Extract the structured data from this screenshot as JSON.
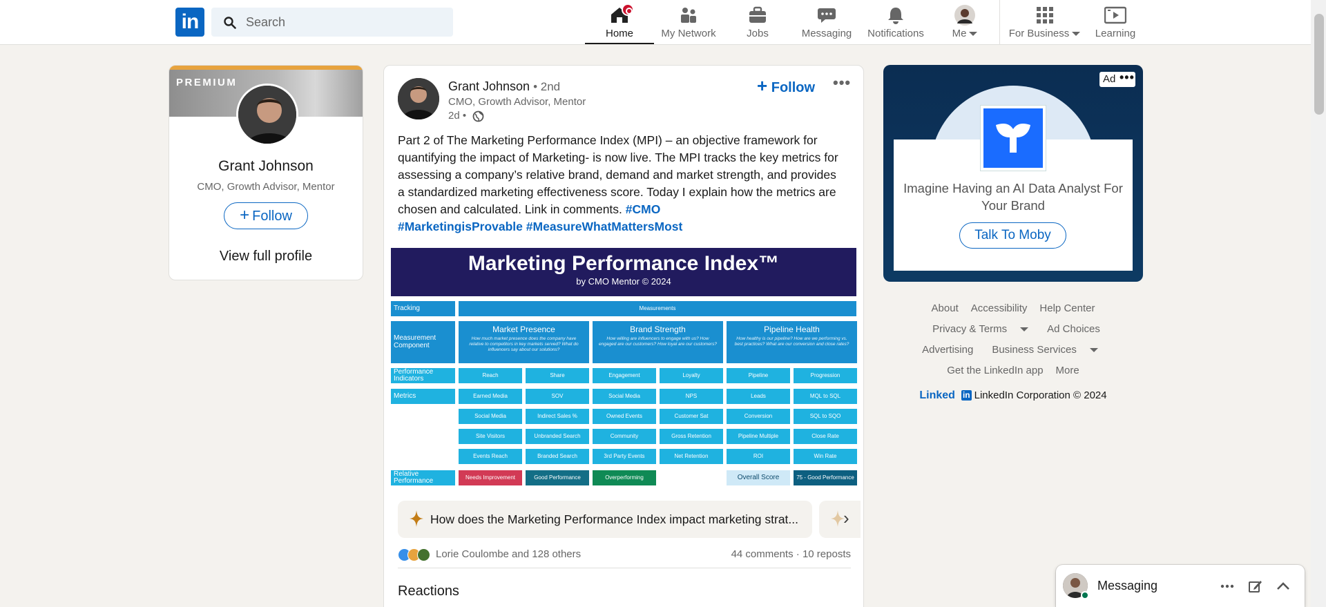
{
  "nav": {
    "logo": "in",
    "search_placeholder": "Search",
    "items": [
      {
        "label": "Home",
        "icon": "home-icon"
      },
      {
        "label": "My Network",
        "icon": "network-icon"
      },
      {
        "label": "Jobs",
        "icon": "jobs-icon"
      },
      {
        "label": "Messaging",
        "icon": "messaging-icon"
      },
      {
        "label": "Notifications",
        "icon": "bell-icon"
      },
      {
        "label": "Me",
        "icon": "avatar"
      },
      {
        "label": "For Business",
        "icon": "grid-icon"
      },
      {
        "label": "Learning",
        "icon": "learning-icon"
      }
    ]
  },
  "profile": {
    "premium": "PREMIUM",
    "name": "Grant Johnson",
    "headline": "CMO, Growth Advisor, Mentor",
    "follow": "Follow",
    "view": "View full profile"
  },
  "post": {
    "author": "Grant Johnson",
    "degree": "• 2nd",
    "headline": "CMO, Growth Advisor, Mentor",
    "time": "2d •",
    "follow": "Follow",
    "more": "•••",
    "text": "Part 2 of The Marketing Performance Index (MPI) – an objective framework for quantifying the impact of Marketing- is now live.  The MPI tracks the key metrics for assessing a company’s relative brand, demand and market strength, and provides a standardized marketing effectiveness score. Today I explain how the metrics are chosen and calculated.  Link in comments. ",
    "tags": [
      "#CMO",
      "#MarketingisProvable",
      "#MeasureWhatMattersMost"
    ],
    "ai_question": "How does the Marketing Performance Index impact marketing strat...",
    "reactors": "Lorie Coulombe and 128 others",
    "comments": "44 comments",
    "reposts": "10 reposts",
    "reactions_heading": "Reactions"
  },
  "infographic": {
    "title": "Marketing Performance Index™",
    "subtitle": "by CMO Mentor © 2024",
    "tracking": "Tracking",
    "measurements": "Measurements",
    "row_labels": [
      "Measurement Component",
      "Performance Indicators",
      "Metrics",
      "Relative Performance"
    ],
    "components": [
      {
        "name": "Market Presence",
        "questions": "How much market presence does the company have relative to competitors in key markets served? What do influencers say about our solutions?"
      },
      {
        "name": "Brand Strength",
        "questions": "How willing are influencers to engage with us? How engaged are our customers? How loyal are our customers?"
      },
      {
        "name": "Pipeline Health",
        "questions": "How healthy is our pipeline? How are we performing vs. best practices? What are our conversion and close rates?"
      }
    ],
    "indicators": [
      "Reach",
      "Share",
      "Engagement",
      "Loyalty",
      "Pipeline",
      "Progression"
    ],
    "metrics": [
      [
        "Earned Media",
        "SOV",
        "Social Media",
        "NPS",
        "Leads",
        "MQL to SQL"
      ],
      [
        "Social Media",
        "Indirect Sales %",
        "Owned Events",
        "Customer Sat",
        "Conversion",
        "SQL to SQO"
      ],
      [
        "Site Visitors",
        "Unbranded Search",
        "Community",
        "Gross Retention",
        "Pipeline Multiple",
        "Close Rate"
      ],
      [
        "Events Reach",
        "Branded Search",
        "3rd Party Events",
        "Net Retention",
        "ROI",
        "Win Rate"
      ]
    ],
    "legend": [
      "Needs Improvement",
      "Good Performance",
      "Overperforming",
      "Overall Score",
      "75 - Good Performance"
    ],
    "colors": {
      "header": "#211b5e",
      "blue": "#1a8fd0",
      "cyan": "#1fb2e0",
      "red": "#d23a55",
      "teal": "#136e86",
      "green": "#0f8a55",
      "pale": "#cfe9f7",
      "dark": "#0d5f80"
    }
  },
  "ad": {
    "label": "Ad",
    "more": "•••",
    "headline": "Imagine Having an AI Data Analyst For Your Brand",
    "cta": "Talk To Moby"
  },
  "footer": {
    "rows": [
      [
        "About",
        "Accessibility",
        "Help Center"
      ],
      [
        "Privacy & Terms",
        "Ad Choices"
      ],
      [
        "Advertising",
        "Business Services"
      ],
      [
        "Get the LinkedIn app",
        "More"
      ]
    ],
    "brand_word": "Linked",
    "brand_in": "in",
    "copyright": "LinkedIn Corporation © 2024"
  },
  "messaging": {
    "title": "Messaging"
  }
}
